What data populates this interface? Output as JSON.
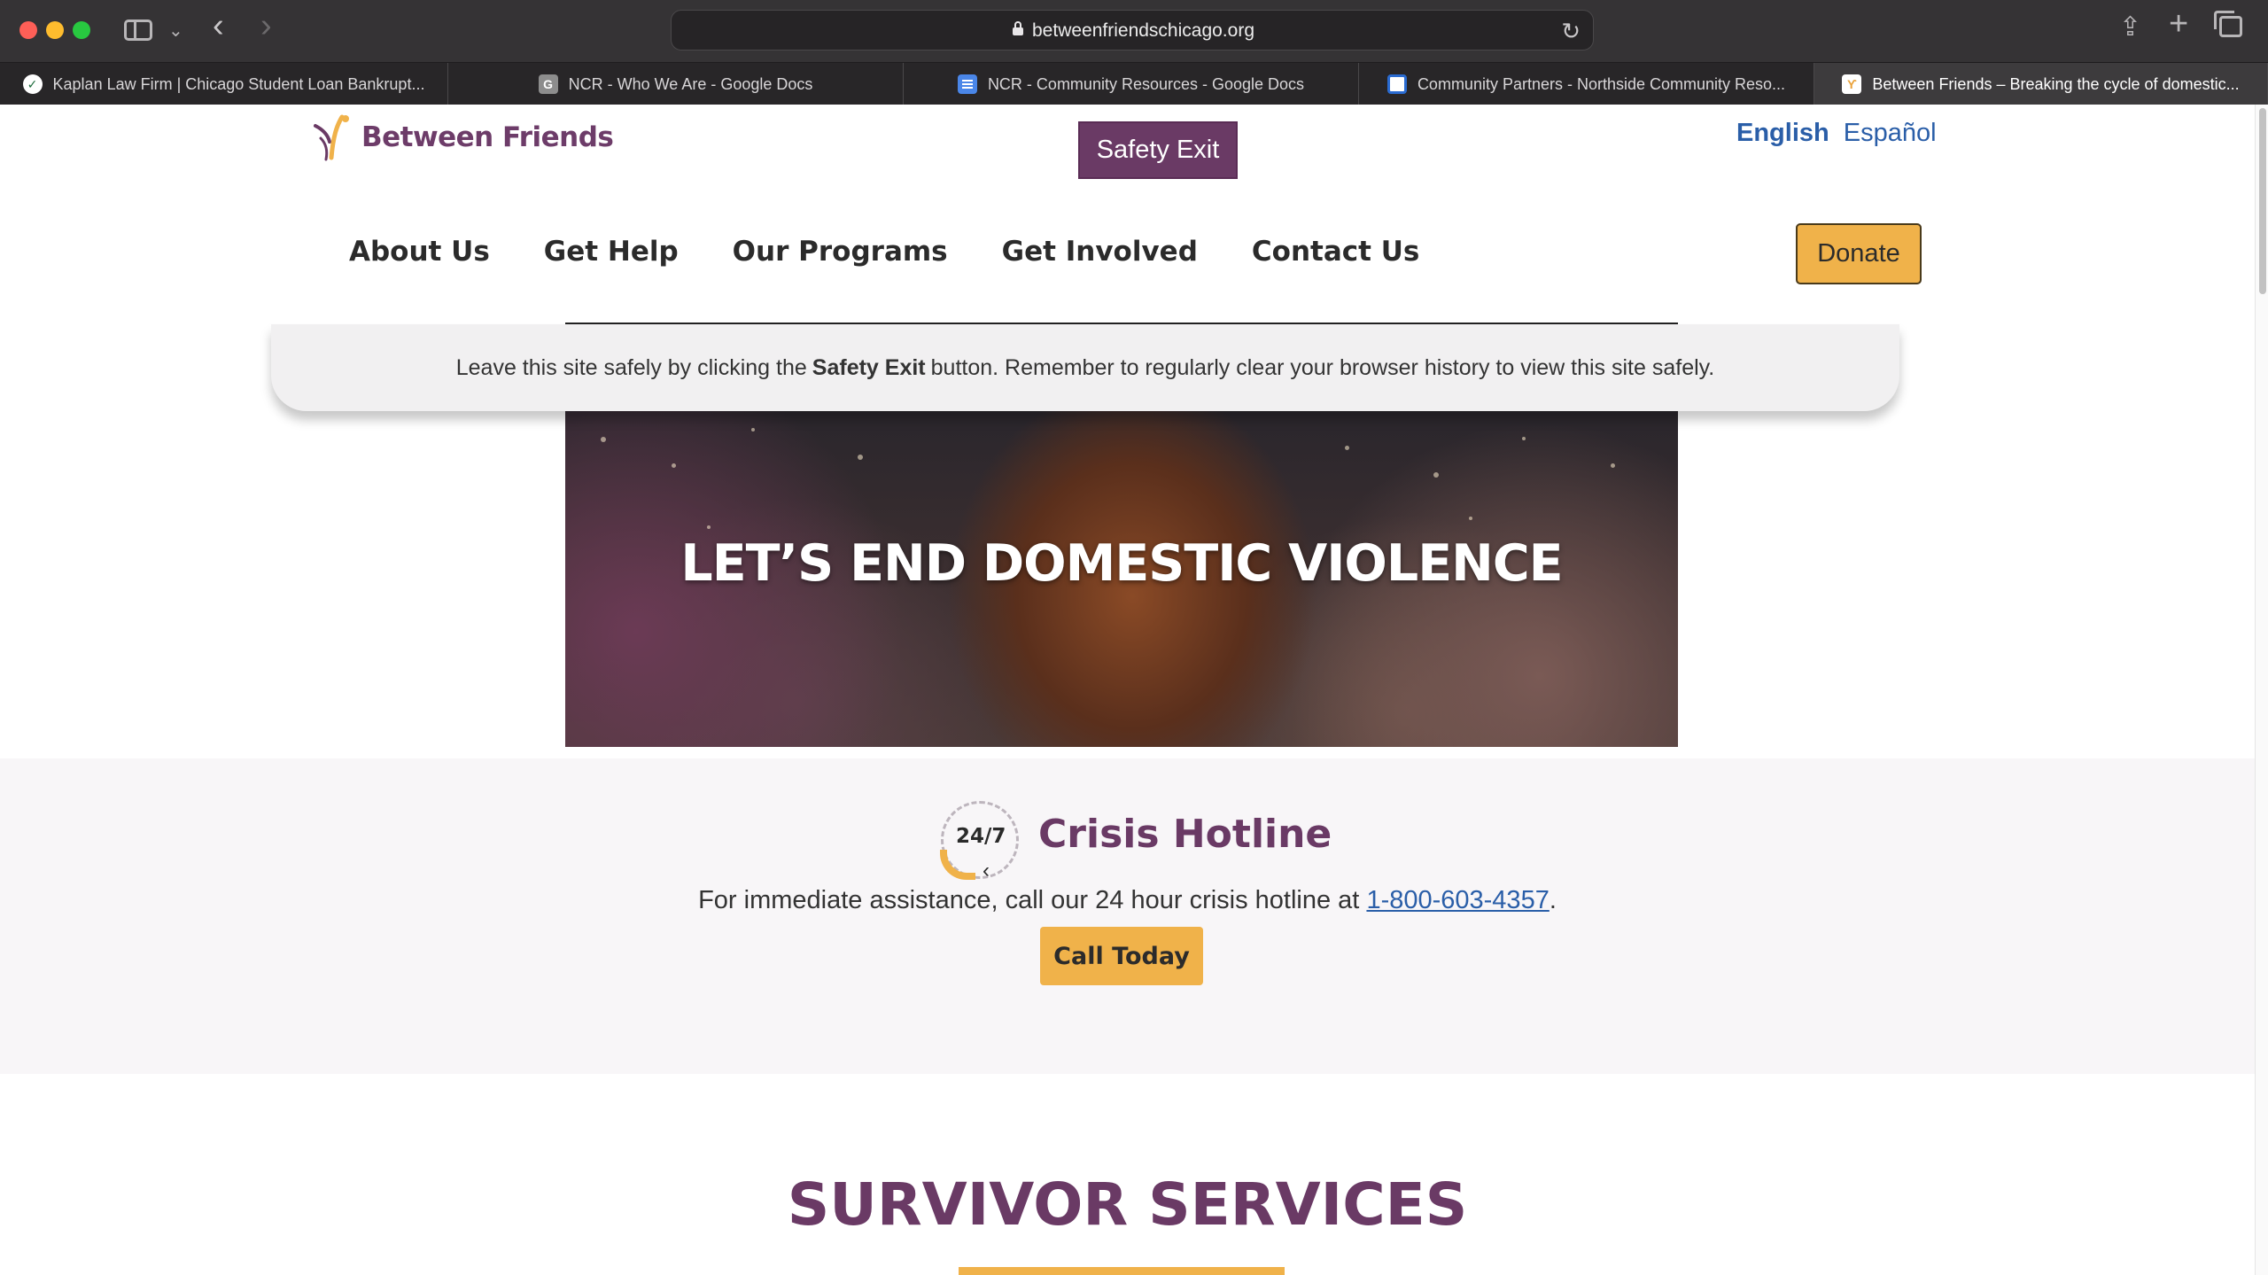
{
  "browser": {
    "url": "betweenfriendschicago.org",
    "tabs": [
      {
        "label": "Kaplan Law Firm | Chicago Student Loan Bankrupt...",
        "favicon": "kaplan-favicon"
      },
      {
        "label": "NCR - Who We Are - Google Docs",
        "favicon": "g-favicon"
      },
      {
        "label": "NCR - Community Resources - Google Docs",
        "favicon": "docs-favicon"
      },
      {
        "label": "Community Partners - Northside Community Reso...",
        "favicon": "ncr-favicon"
      },
      {
        "label": "Between Friends – Breaking the cycle of domestic...",
        "favicon": "between-friends-favicon",
        "active": true
      }
    ]
  },
  "header": {
    "logo_text": "Between Friends",
    "safety_exit": "Safety Exit",
    "lang_english": "English",
    "lang_spanish": "Español",
    "donate": "Donate"
  },
  "nav": {
    "items": [
      "About Us",
      "Get Help",
      "Our Programs",
      "Get Involved",
      "Contact Us"
    ]
  },
  "notice": {
    "before": "Leave this site safely by clicking the",
    "bold": "Safety Exit",
    "after": "button. Remember to regularly clear your browser history to view this site safely."
  },
  "hero": {
    "title": "LET’S END DOMESTIC VIOLENCE"
  },
  "crisis": {
    "icon_text": "24/7",
    "title": "Crisis Hotline",
    "text_before": "For immediate assistance, call our 24 hour crisis hotline at",
    "phone": "1-800-603-4357",
    "text_after": ".",
    "button": "Call Today"
  },
  "services": {
    "title": "SURVIVOR SERVICES"
  },
  "colors": {
    "brand_purple": "#6a3a65",
    "accent_gold": "#f0b24a",
    "link_blue": "#2a5ea8"
  }
}
